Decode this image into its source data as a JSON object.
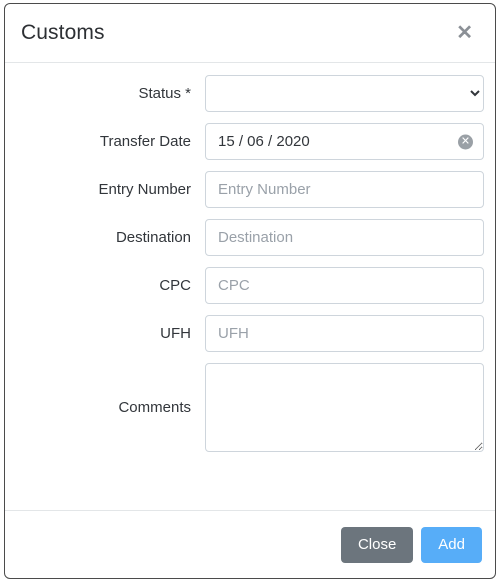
{
  "dialog": {
    "title": "Customs",
    "close_icon": "close-icon"
  },
  "form": {
    "fields": [
      {
        "key": "status",
        "label": "Status *",
        "type": "select",
        "value": "",
        "options": [
          ""
        ]
      },
      {
        "key": "transfer_date",
        "label": "Transfer Date",
        "type": "date",
        "value": "15 / 06 / 2020",
        "placeholder": "Transfer Date",
        "clear_icon": "clear-circle-icon",
        "clear_glyph": "✕"
      },
      {
        "key": "entry_number",
        "label": "Entry Number",
        "type": "text",
        "value": "",
        "placeholder": "Entry Number"
      },
      {
        "key": "destination",
        "label": "Destination",
        "type": "text",
        "value": "",
        "placeholder": "Destination"
      },
      {
        "key": "cpc",
        "label": "CPC",
        "type": "text",
        "value": "",
        "placeholder": "CPC"
      },
      {
        "key": "ufh",
        "label": "UFH",
        "type": "text",
        "value": "",
        "placeholder": "UFH"
      },
      {
        "key": "comments",
        "label": "Comments",
        "type": "textarea",
        "value": "",
        "placeholder": ""
      }
    ]
  },
  "footer": {
    "close_label": "Close",
    "add_label": "Add"
  },
  "colors": {
    "close_button": "#6c757d",
    "add_button": "#57adf8",
    "border": "#ced5dc",
    "text": "#32363b",
    "placeholder": "#9aa1a9"
  }
}
